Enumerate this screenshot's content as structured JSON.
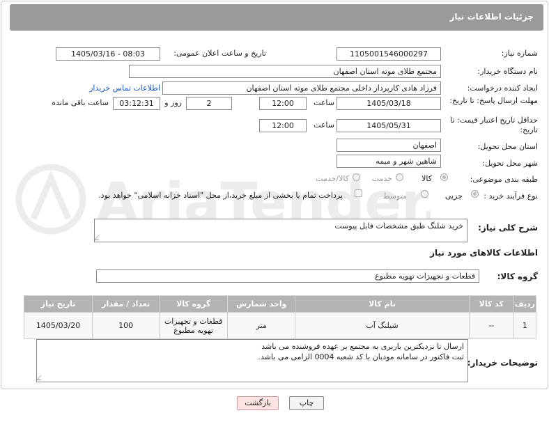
{
  "header": {
    "title": "جزئیات اطلاعات نیاز"
  },
  "fields": {
    "need_number_label": "شماره نیاز:",
    "need_number": "1105001546000297",
    "announce_label": "تاریخ و ساعت اعلان عمومی:",
    "announce_value": "1405/03/16 - 08:03",
    "buyer_org_label": "نام دستگاه خریدار:",
    "buyer_org": "مجتمع طلای موته استان اصفهان",
    "creator_label": "ایجاد کننده درخواست:",
    "creator": "فرزاد هادی کارپرداز داخلی مجتمع طلای موته استان اصفهان",
    "contact_link": "اطلاعات تماس خریدار",
    "reply_deadline_label": "مهلت ارسال پاسخ: تا تاریخ:",
    "reply_date": "1405/03/18",
    "time_word": "ساعت",
    "reply_time": "12:00",
    "days_value": "2",
    "days_and": "روز و",
    "remaining_time": "03:12:31",
    "remaining_label": "ساعت باقی مانده",
    "price_validity_label": "حداقل تاریخ اعتبار قیمت: تا تاریخ:",
    "price_date": "1405/05/31",
    "price_time": "12:00",
    "province_label": "استان محل تحویل:",
    "province": "اصفهان",
    "city_label": "شهر محل تحویل:",
    "city": "شاهین شهر و میمه",
    "category_label": "طبقه بندی موضوعی:",
    "category_options": [
      "کالا",
      "خدمت",
      "کالا/خدمت"
    ],
    "process_label": "نوع فرآیند خرید :",
    "process_options": [
      "جزیی",
      "متوسط"
    ],
    "payment_note": "پرداخت تمام یا بخشی از مبلغ خرید،از محل \"اسناد خزانه اسلامی\" خواهد بود."
  },
  "description": {
    "label": "شرح کلی نیاز:",
    "value": "خرید شلنگ طبق مشخصات فایل پیوست"
  },
  "goods": {
    "section_title": "اطلاعات کالاهای مورد نیاز",
    "group_label": "گروه کالا:",
    "group_value": "قطعات و تجهیزات تهویه مطبوع"
  },
  "table": {
    "headers": [
      "ردیف",
      "کد کالا",
      "نام کالا",
      "واحد شمارش",
      "گروه کالا",
      "تعداد / مقدار",
      "تاریخ نیاز"
    ],
    "rows": [
      [
        "1",
        "--",
        "شیلنگ آب",
        "متر",
        "قطعات و تجهیزات تهویه مطبوع",
        "100",
        "1405/03/20"
      ]
    ]
  },
  "buyer_notes": {
    "label": "توضیحات خریدار:",
    "line1": "ارسال تا نزدیکترین باربری به  مجتمع بر عهده فروشنده می باشد",
    "line2": "ثبت فاکتور در سامانه مودیان با کد شعبه 0004 الزامی می باشد."
  },
  "buttons": {
    "print": "چاپ",
    "back": "بازگشت"
  },
  "watermark": "AriaTender.neT",
  "colors": {
    "title_bar": "#9a9a9a",
    "table_header": "#b3b3b3",
    "link": "#1a56c7",
    "back_button": "#fde3e3"
  }
}
